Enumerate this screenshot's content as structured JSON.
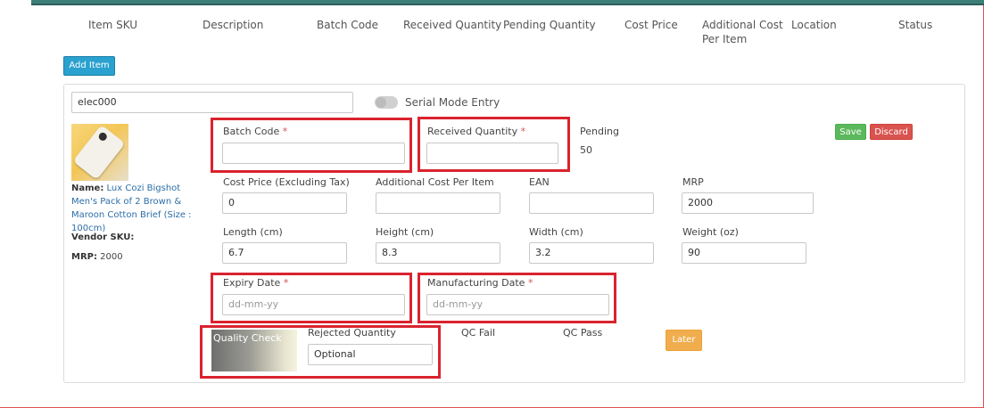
{
  "columns": [
    "Item SKU",
    "Description",
    "Batch Code",
    "Received Quantity",
    "Pending Quantity",
    "Cost Price",
    "Additional Cost Per Item",
    "Location",
    "Status"
  ],
  "add_item_label": "Add Item",
  "item_search_value": "elec000",
  "serial_mode_label": "Serial Mode Entry",
  "product": {
    "name_label": "Name:",
    "name_value": "Lux Cozi Bigshot Men's Pack of 2 Brown & Maroon Cotton Brief (Size : 100cm)",
    "vendor_sku_label": "Vendor SKU:",
    "mrp_label": "MRP:",
    "mrp_value": "2000"
  },
  "batch_code": {
    "label": "Batch Code",
    "required": "*",
    "value": ""
  },
  "received_quantity": {
    "label": "Received Quantity",
    "required": "*",
    "value": ""
  },
  "pending": {
    "label": "Pending",
    "value": "50"
  },
  "save_label": "Save",
  "discard_label": "Discard",
  "cost_price": {
    "label": "Cost Price (Excluding Tax)",
    "value": "0"
  },
  "additional_cost": {
    "label": "Additional Cost Per Item",
    "value": ""
  },
  "ean": {
    "label": "EAN",
    "value": ""
  },
  "mrp": {
    "label": "MRP",
    "value": "2000"
  },
  "length": {
    "label": "Length (cm)",
    "value": "6.7"
  },
  "height": {
    "label": "Height (cm)",
    "value": "8.3"
  },
  "width": {
    "label": "Width (cm)",
    "value": "3.2"
  },
  "weight": {
    "label": "Weight (oz)",
    "value": "90"
  },
  "expiry_date": {
    "label": "Expiry Date",
    "required": "*",
    "placeholder": "dd-mm-yy"
  },
  "manufacturing_date": {
    "label": "Manufacturing Date",
    "required": "*",
    "placeholder": "dd-mm-yy"
  },
  "quality_check_label": "Quality Check",
  "rejected_quantity": {
    "label": "Rejected Quantity",
    "value": "Optional"
  },
  "qc_fail_label": "QC Fail",
  "qc_pass_label": "QC Pass",
  "later_label": "Later",
  "colors": {
    "highlight": "#d9232e",
    "add_button": "#2aa1cf",
    "save_button": "#5cb85c",
    "discard_button": "#d9534f",
    "later_button": "#f0ad4e",
    "top_bar": "#3d7e78"
  }
}
